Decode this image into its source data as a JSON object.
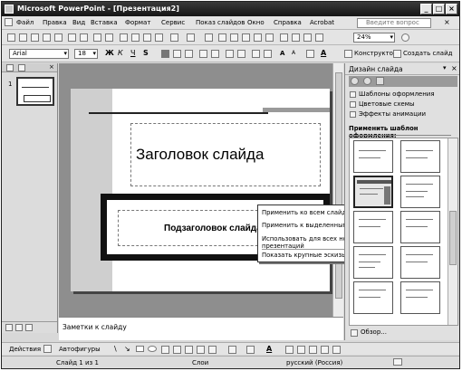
{
  "titlebar": {
    "title": "Microsoft PowerPoint - [Презентация2]"
  },
  "menu": [
    "Файл",
    "Правка",
    "Вид",
    "Вставка",
    "Формат",
    "Сервис",
    "Показ слайдов",
    "Окно",
    "Справка",
    "Acrobat"
  ],
  "help_placeholder": "Введите вопрос",
  "toolbar": {
    "zoom": "24%",
    "font": "Arial",
    "font_size": "18",
    "bold": "Ж",
    "italic": "К",
    "underline": "Ч",
    "shadow": "S",
    "constructor": "Конструктор",
    "new_slide": "Создать слайд"
  },
  "slide": {
    "title": "Заголовок слайда",
    "subtitle": "Подзаголовок слайда"
  },
  "context_menu": [
    "Применить ко всем слайдам",
    "Применить к выделенным слайдам",
    "Использовать для всех новых презентаций",
    "Показать крупные эскизы"
  ],
  "taskpane": {
    "title": "Дизайн слайда",
    "links": [
      "Шаблоны оформления",
      "Цветовые схемы",
      "Эффекты анимации"
    ],
    "section": "Применить шаблон оформления:",
    "browse": "Обзор..."
  },
  "left_pane": {
    "slide_number": "1"
  },
  "notes": {
    "placeholder": "Заметки к слайду"
  },
  "drawbar": {
    "actions": "Действия",
    "autoshapes": "Автофигуры"
  },
  "status": {
    "slide": "Слайд 1 из 1",
    "layout": "Слои",
    "language": "русский (Россия)"
  }
}
